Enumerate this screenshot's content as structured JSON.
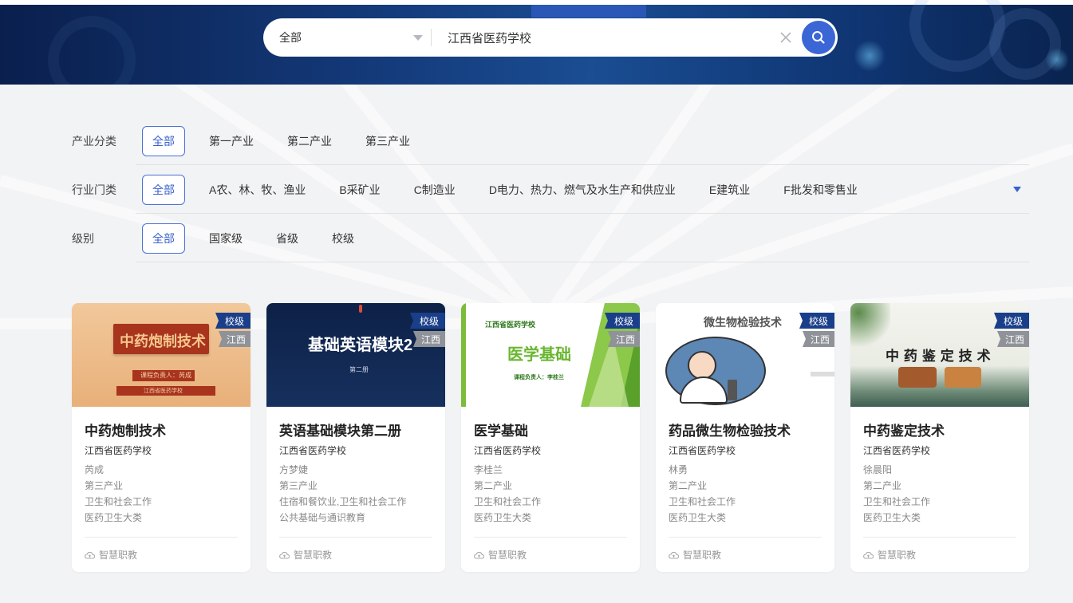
{
  "search": {
    "scope": "全部",
    "query": "江西省医药学校"
  },
  "filters": [
    {
      "label": "产业分类",
      "options": [
        "全部",
        "第一产业",
        "第二产业",
        "第三产业"
      ]
    },
    {
      "label": "行业门类",
      "options": [
        "全部",
        "A农、林、牧、渔业",
        "B采矿业",
        "C制造业",
        "D电力、热力、燃气及水生产和供应业",
        "E建筑业",
        "F批发和零售业"
      ]
    },
    {
      "label": "级别",
      "options": [
        "全部",
        "国家级",
        "省级",
        "校级"
      ]
    }
  ],
  "cards": [
    {
      "title": "中药炮制技术",
      "school": "江西省医药学校",
      "teacher": "芮成",
      "industry": "第三产业",
      "sector": "卫生和社会工作",
      "category": "医药卫生大类",
      "extra": "",
      "level": "校级",
      "province": "江西",
      "platform": "智慧职教",
      "cover": {
        "title": "中药炮制技术",
        "sub1": "课程负责人：芮成",
        "sub2": "江西省医药学校"
      }
    },
    {
      "title": "英语基础模块第二册",
      "school": "江西省医药学校",
      "teacher": "方梦婕",
      "industry": "第三产业",
      "sector": "住宿和餐饮业,卫生和社会工作",
      "category": "公共基础与通识教育",
      "extra": "",
      "level": "校级",
      "province": "江西",
      "platform": "智慧职教",
      "cover": {
        "title": "基础英语模块2",
        "sub1": "第二册"
      }
    },
    {
      "title": "医学基础",
      "school": "江西省医药学校",
      "teacher": "李桂兰",
      "industry": "第二产业",
      "sector": "卫生和社会工作",
      "category": "医药卫生大类",
      "extra": "",
      "level": "校级",
      "province": "江西",
      "platform": "智慧职教",
      "cover": {
        "school": "江西省医药学校",
        "title": "医学基础",
        "sub1": "课程负责人：李桂兰"
      }
    },
    {
      "title": "药品微生物检验技术",
      "school": "江西省医药学校",
      "teacher": "林勇",
      "industry": "第二产业",
      "sector": "卫生和社会工作",
      "category": "医药卫生大类",
      "extra": "",
      "level": "校级",
      "province": "江西",
      "platform": "智慧职教",
      "cover": {
        "title": "微生物检验技术"
      }
    },
    {
      "title": "中药鉴定技术",
      "school": "江西省医药学校",
      "teacher": "徐晨阳",
      "industry": "第二产业",
      "sector": "卫生和社会工作",
      "category": "医药卫生大类",
      "extra": "",
      "level": "校级",
      "province": "江西",
      "platform": "智慧职教",
      "cover": {
        "title": "中 药 鉴 定 技 术"
      }
    }
  ]
}
